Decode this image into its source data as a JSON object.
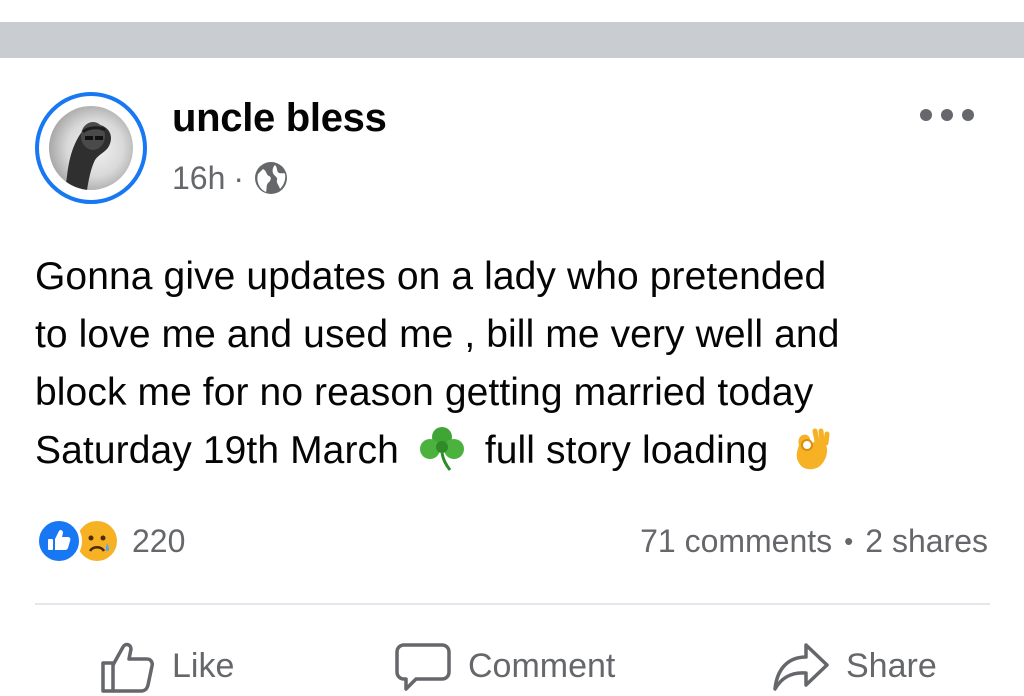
{
  "post": {
    "author": "uncle bless",
    "time": "16h",
    "separator": "·",
    "audience_icon": "globe-icon",
    "more_icon": "more-horizontal-icon",
    "text_line1": "Gonna give updates on a lady who pretended",
    "text_line2": "to love me and used me , bill me very well and",
    "text_line3": "block me for no reason getting married today",
    "text_line4a": "Saturday 19th March",
    "text_emoji1": "shamrock",
    "text_line4b": "full story loading",
    "text_emoji2": "ok-hand"
  },
  "reactions": {
    "icons": [
      "like-reaction-icon",
      "sad-reaction-icon"
    ],
    "count": "220"
  },
  "stats": {
    "comments": "71 comments",
    "separator": "•",
    "shares": "2 shares"
  },
  "actions": {
    "like": "Like",
    "comment": "Comment",
    "share": "Share"
  },
  "colors": {
    "accent": "#1877f2",
    "secondary_text": "#65676b",
    "divider": "#c9ccd1",
    "sad_reaction": "#f7b125"
  }
}
